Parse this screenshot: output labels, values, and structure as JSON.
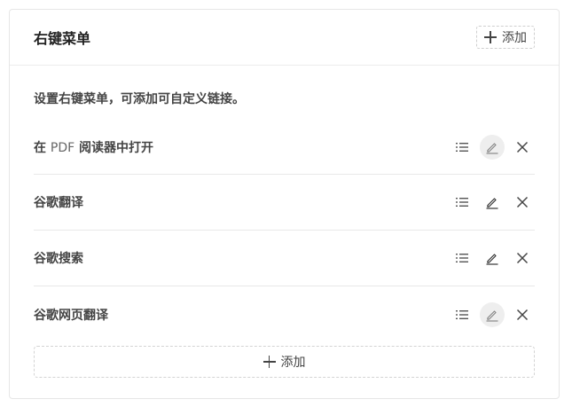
{
  "header": {
    "title": "右键菜单",
    "add_label": "添加"
  },
  "description": "设置右键菜单，可添加可自定义链接。",
  "items": [
    {
      "label_prefix": "在 ",
      "label_light": "PDF",
      "label_suffix": " 阅读器中打开",
      "edit_active": true
    },
    {
      "label": "谷歌翻译",
      "edit_active": false
    },
    {
      "label": "谷歌搜索",
      "edit_active": false
    },
    {
      "label": "谷歌网页翻译",
      "edit_active": true
    }
  ],
  "footer": {
    "add_label": "添加"
  },
  "icons": {
    "drag": "list-drag-icon",
    "edit": "pencil-edit-icon",
    "delete": "close-x-icon",
    "add": "plus-icon"
  }
}
